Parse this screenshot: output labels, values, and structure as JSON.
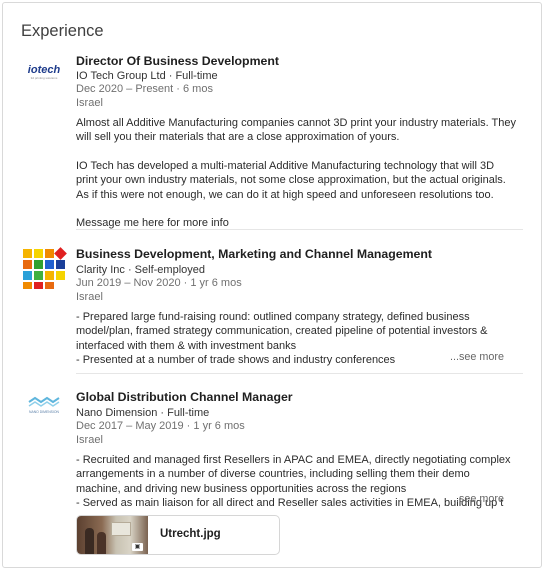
{
  "section": {
    "title": "Experience"
  },
  "entries": [
    {
      "logo_icon": "iotech-logo",
      "logo_text": "iotech",
      "logo_subtext": "3d printing solutions",
      "title": "Director Of Business Development",
      "company": "IO Tech Group Ltd · Full-time",
      "dates": "Dec 2020 – Present · 6 mos",
      "location": "Israel",
      "description": [
        "Almost all Additive Manufacturing companies cannot 3D print your industry materials. They will sell you their materials that are a close approximation of yours.",
        "IO Tech has developed a multi-material Additive Manufacturing technology that will 3D print your own industry materials, not some close approximation, but the actual originals. As if this were not enough, we can do it at high speed and unforeseen resolutions too.",
        "Message me here for more info"
      ]
    },
    {
      "logo_icon": "clarity-colored-squares-logo",
      "logo_colors": [
        "#f5b400",
        "#f5d400",
        "#f08a00",
        "#e02020",
        "#e86a10",
        "#30a030",
        "#2060d0",
        "#1a3f9a",
        "#2aa0d8",
        "#40b040"
      ],
      "title": "Business Development, Marketing and Channel Management",
      "company": "Clarity Inc · Self-employed",
      "dates": "Jun 2019 – Nov 2020 · 1 yr 6 mos",
      "location": "Israel",
      "description": [
        "- Prepared large fund-raising round: outlined company strategy, defined business model/plan, framed strategy communication, created pipeline of potential investors & interfaced with them & with investment banks",
        "- Presented at a number of trade shows and industry conferences"
      ],
      "see_more": "...see more"
    },
    {
      "logo_icon": "nano-dimension-logo",
      "logo_text": "NANO DIMENSION",
      "title": "Global Distribution Channel Manager",
      "company": "Nano Dimension · Full-time",
      "dates": "Dec 2017 – May 2019 · 1 yr 6 mos",
      "location": "Israel",
      "description": [
        "- Recruited and managed first Resellers in APAC and EMEA, directly negotiating complex arrangements in a number of diverse countries, including selling them their demo machine, and driving new business opportunities across the regions",
        "- Served as main liaison for all direct and Reseller sales activities in EMEA, building up t"
      ],
      "see_more": "...see more",
      "attachment": {
        "name": "Utrecht.jpg",
        "icon": "photo-thumbnail"
      }
    }
  ]
}
